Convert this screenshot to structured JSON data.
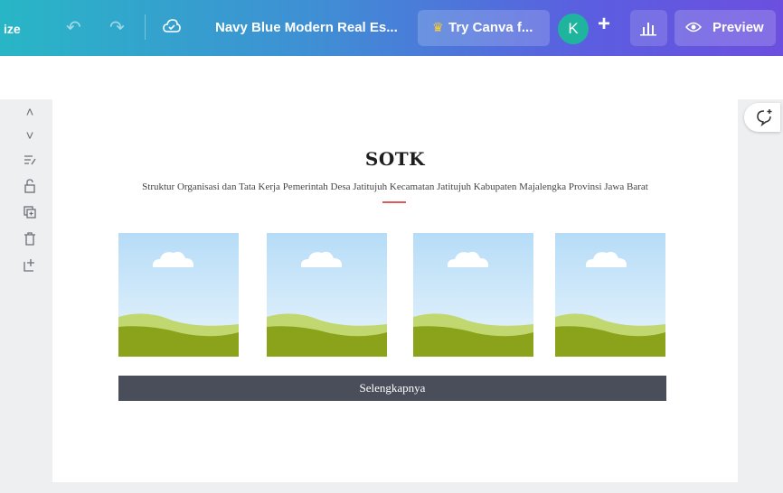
{
  "toolbar": {
    "resize_label": "ize",
    "design_title": "Navy Blue Modern Real Es...",
    "try_canva_label": "Try Canva f...",
    "avatar_initial": "K",
    "preview_label": "Preview",
    "icons": [
      "undo-icon",
      "redo-icon",
      "cloud-saved-icon",
      "crown-icon",
      "add-collaborator-icon",
      "insights-icon",
      "eye-icon"
    ]
  },
  "sidebar": {
    "icons": [
      "chevron-up-icon",
      "chevron-down-icon",
      "notes-icon",
      "lock-icon",
      "duplicate-icon",
      "trash-icon",
      "add-page-icon"
    ]
  },
  "canvas": {
    "title": "SOTK",
    "subtitle": "Struktur Organisasi dan Tata Kerja Pemerintah Desa Jatitujuh Kecamatan Jatitujuh Kabupaten Majalengka Provinsi Jawa Barat",
    "button_label": "Selengkapnya",
    "accent_color": "#e05a5a",
    "button_color": "#4a4d5a",
    "image_placeholders": 4
  }
}
